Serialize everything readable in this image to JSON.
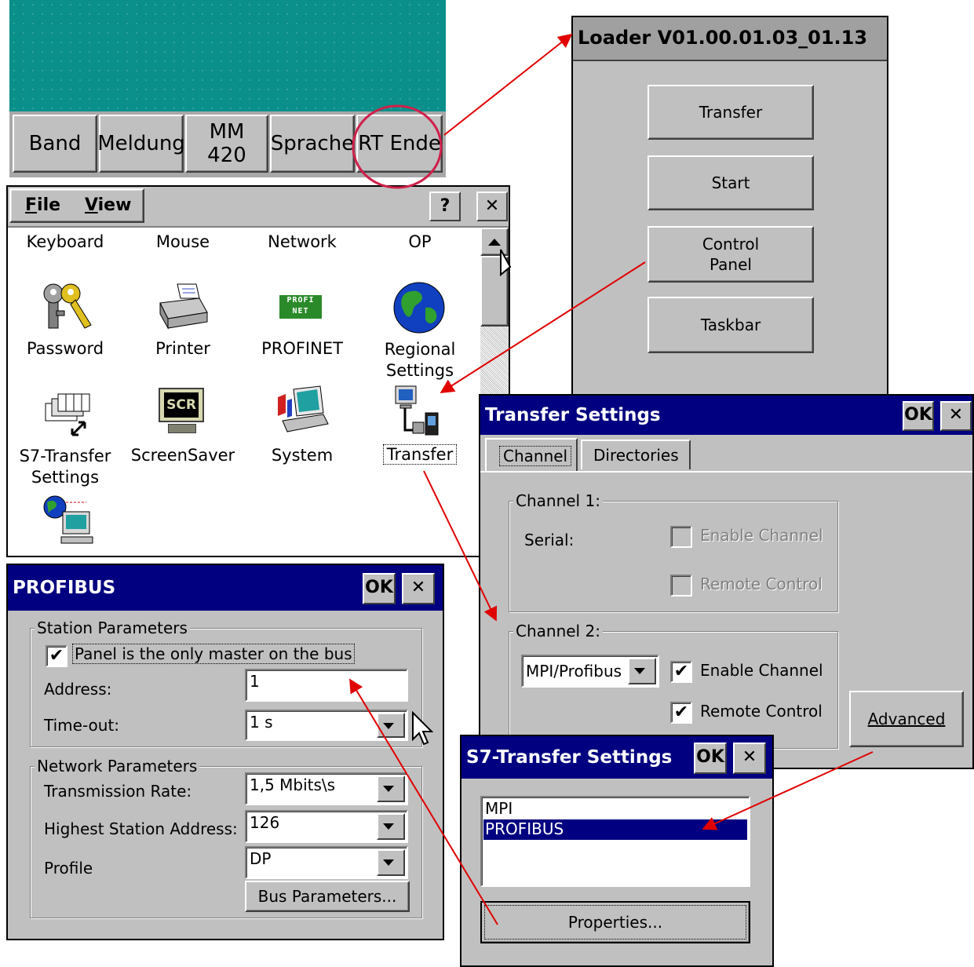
{
  "taskbar": {
    "buttons": [
      "Band",
      "Meldung",
      "MM 420",
      "Sprache",
      "RT Ende"
    ]
  },
  "loader": {
    "title": "Loader V01.00.01.03_01.13",
    "buttons": [
      "Transfer",
      "Start",
      "Control\nPanel",
      "Taskbar"
    ]
  },
  "control_panel": {
    "menu": [
      "File",
      "View"
    ],
    "help": "?",
    "close": "✕",
    "row1_labels": [
      "Keyboard",
      "Mouse",
      "Network",
      "OP"
    ],
    "row2_labels": [
      "Password",
      "Printer",
      "PROFINET",
      "Regional Settings"
    ],
    "row3_labels": [
      "S7-Transfer Settings",
      "ScreenSaver",
      "System",
      "Transfer"
    ],
    "screensaver_icon_text": "SCR"
  },
  "transfer_settings": {
    "title": "Transfer Settings",
    "ok": "OK",
    "close": "✕",
    "tabs": [
      "Channel",
      "Directories"
    ],
    "channel1": {
      "group": "Channel 1:",
      "serial_label": "Serial:",
      "enable": "Enable Channel",
      "remote": "Remote Control",
      "enable_checked": false,
      "remote_checked": false
    },
    "channel2": {
      "group": "Channel 2:",
      "protocol": "MPI/Profibus",
      "enable": "Enable Channel",
      "remote": "Remote Control",
      "enable_checked": true,
      "remote_checked": true
    },
    "advanced": "Advanced"
  },
  "s7_transfer": {
    "title": "S7-Transfer Settings",
    "ok": "OK",
    "close": "✕",
    "list": [
      "MPI",
      "PROFIBUS"
    ],
    "selected": "PROFIBUS",
    "properties": "Properties..."
  },
  "profibus": {
    "title": "PROFIBUS",
    "ok": "OK",
    "close": "✕",
    "station_group": "Station Parameters",
    "only_master": "Panel is the only master on the bus",
    "only_master_checked": true,
    "address_label": "Address:",
    "address_value": "1",
    "timeout_label": "Time-out:",
    "timeout_value": "1 s",
    "network_group": "Network Parameters",
    "rate_label": "Transmission Rate:",
    "rate_value": "1,5 Mbits\\s",
    "hsa_label": "Highest Station Address:",
    "hsa_value": "126",
    "profile_label": "Profile",
    "profile_value": "DP",
    "bus_params": "Bus Parameters..."
  },
  "colors": {
    "title_bar": "#000080",
    "face": "#c0c0c0",
    "teal": "#008080",
    "arrow": "#e00000",
    "circle": "#d0204a"
  }
}
